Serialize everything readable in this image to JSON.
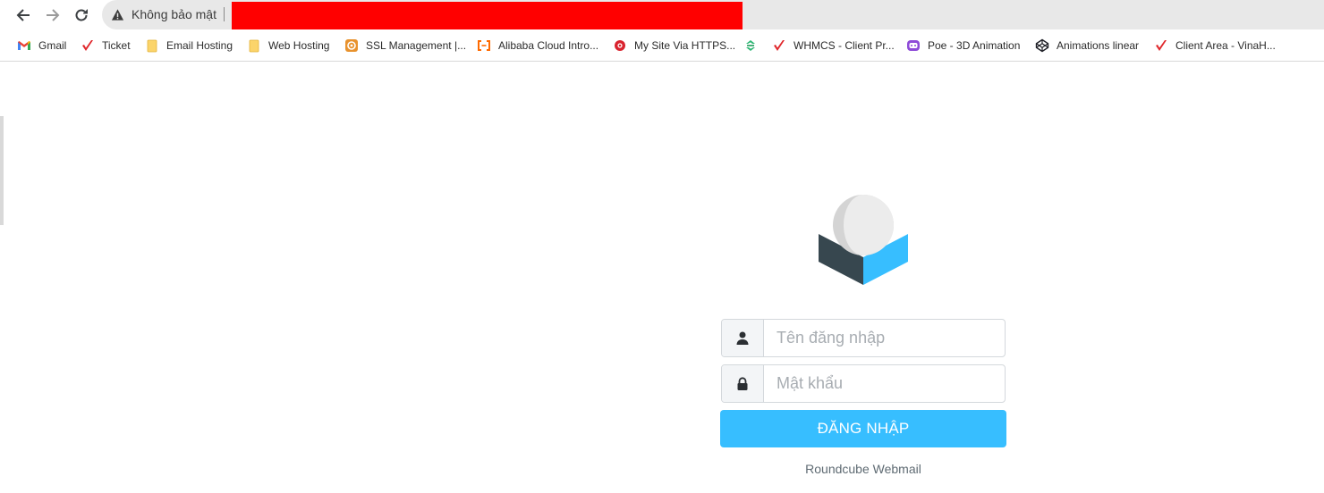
{
  "browser": {
    "security_label": "Không bảo mật",
    "url_redaction_color": "#ff0000",
    "nav_icons": [
      "back-arrow-icon",
      "forward-arrow-icon",
      "reload-icon"
    ],
    "bookmarks": [
      {
        "label": "Gmail",
        "icon": "gmail-icon"
      },
      {
        "label": "Ticket",
        "icon": "red-check-icon"
      },
      {
        "label": "Email Hosting",
        "icon": "folder-icon"
      },
      {
        "label": "Web Hosting",
        "icon": "folder-icon"
      },
      {
        "label": "SSL Management |...",
        "icon": "ssl-icon"
      },
      {
        "label": "Alibaba Cloud Intro...",
        "icon": "alibaba-icon"
      },
      {
        "label": "My Site Via HTTPS...",
        "icon": "red-circle-icon"
      },
      {
        "label": "",
        "icon": "green-logo-icon"
      },
      {
        "label": "WHMCS - Client Pr...",
        "icon": "red-check-icon"
      },
      {
        "label": "Poe - 3D Animation",
        "icon": "poe-icon"
      },
      {
        "label": "Animations linear",
        "icon": "codepen-icon"
      },
      {
        "label": "Client Area - VinaH...",
        "icon": "red-check-icon"
      }
    ]
  },
  "login": {
    "username_placeholder": "Tên đăng nhập",
    "password_placeholder": "Mật khẩu",
    "submit_label": "ĐĂNG NHẬP",
    "product_name": "Roundcube Webmail",
    "accent_color": "#37beff",
    "logo_icon": "roundcube-logo-icon"
  }
}
